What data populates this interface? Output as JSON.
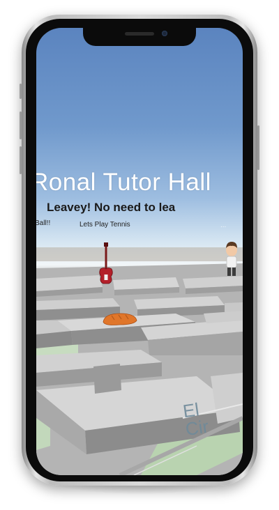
{
  "scene": {
    "building_title": "Ronal Tutor Hall",
    "message": "Leavey! No need to lea",
    "labels": {
      "ball": "Ball!!",
      "tennis": "Lets Play Tennis",
      "right_faded": "..."
    },
    "map_text": [
      "El",
      "Cir"
    ],
    "icons": [
      "guitar-icon",
      "avatar-character-icon",
      "bread-loaf-icon"
    ]
  }
}
